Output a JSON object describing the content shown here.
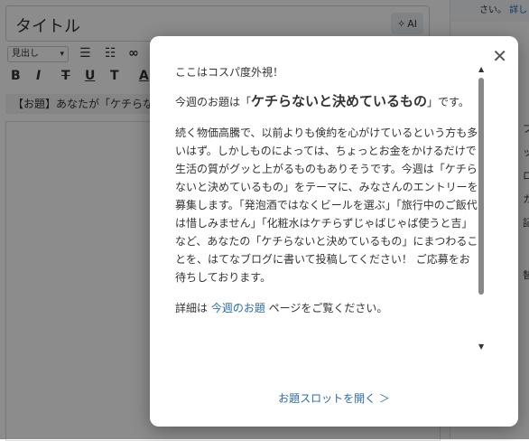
{
  "editor": {
    "title_text": "タイトル",
    "ai_label": "AI",
    "format_select": "見出し",
    "toolbar_bold": "B",
    "toolbar_italic": "I",
    "toolbar_strike": "T",
    "toolbar_underline": "U",
    "toolbar_size": "T",
    "toolbar_color": "A",
    "topic_text": "【お題】あなたが「ケチらな"
  },
  "right_panel": {
    "top_text": "さい。",
    "top_link": "詳し",
    "chars": [
      "プ",
      "ッ",
      "ロ",
      "カ",
      "記",
      "替"
    ]
  },
  "modal": {
    "line1": "ここはコスパ度外視！",
    "topic_prefix": "今週のお題は「",
    "topic_main": "ケチらないと決めているもの",
    "topic_suffix": "」です。",
    "body": "続く物価高騰で、以前よりも倹約を心がけているという方も多いはず。しかしものによっては、ちょっとお金をかけるだけで生活の質がグッと上がるものもありそうです。今週は「ケチらないと決めているもの」をテーマに、みなさんのエントリーを募集します。「発泡酒ではなくビールを選ぶ」「旅行中のご飯代は惜しみません」「化粧水はケチらずじゃばじゃば使うと吉」など、あなたの「ケチらないと決めているもの」にまつわることを、はてなブログに書いて投稿してください！ ご応募をお待ちしております。",
    "details_prefix": "詳細は ",
    "details_link": "今週のお題",
    "details_suffix": " ページをご覧ください。",
    "footer_link": "お題スロットを開く ＞"
  },
  "icons": {
    "close": "close-icon",
    "sparkle": "sparkle-icon",
    "gear": "gear-icon",
    "list_bullet": "bullet-list-icon",
    "list_number": "numbered-list-icon",
    "link": "link-icon"
  }
}
